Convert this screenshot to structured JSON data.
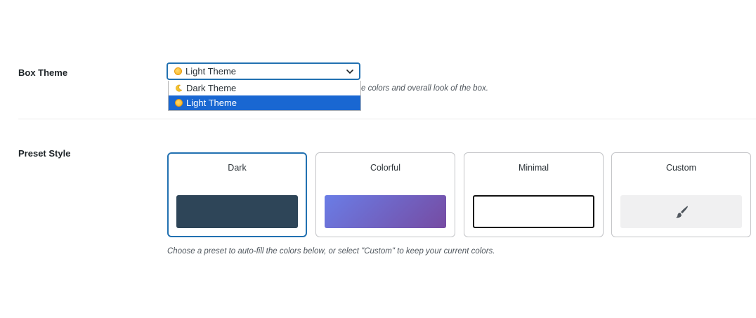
{
  "box_theme": {
    "label": "Box Theme",
    "selected_value": "Light Theme",
    "selected_icon": "sun-icon",
    "options": [
      {
        "label": "Dark Theme",
        "icon": "moon-icon",
        "selected": false
      },
      {
        "label": "Light Theme",
        "icon": "sun-icon",
        "selected": true
      }
    ],
    "help_visible": "e colors and overall look of the box."
  },
  "preset_style": {
    "label": "Preset Style",
    "cards": [
      {
        "title": "Dark",
        "selected": true,
        "color": "#2e4558"
      },
      {
        "title": "Colorful",
        "selected": false,
        "color_from": "#6a7de6",
        "color_to": "#764ba2"
      },
      {
        "title": "Minimal",
        "selected": false,
        "color": "#ffffff"
      },
      {
        "title": "Custom",
        "selected": false,
        "icon": "paintbrush-icon"
      }
    ],
    "help": "Choose a preset to auto-fill the colors below, or select \"Custom\" to keep your current colors."
  },
  "colors": {
    "accent": "#2271b1",
    "option_highlight": "#1967d2"
  }
}
